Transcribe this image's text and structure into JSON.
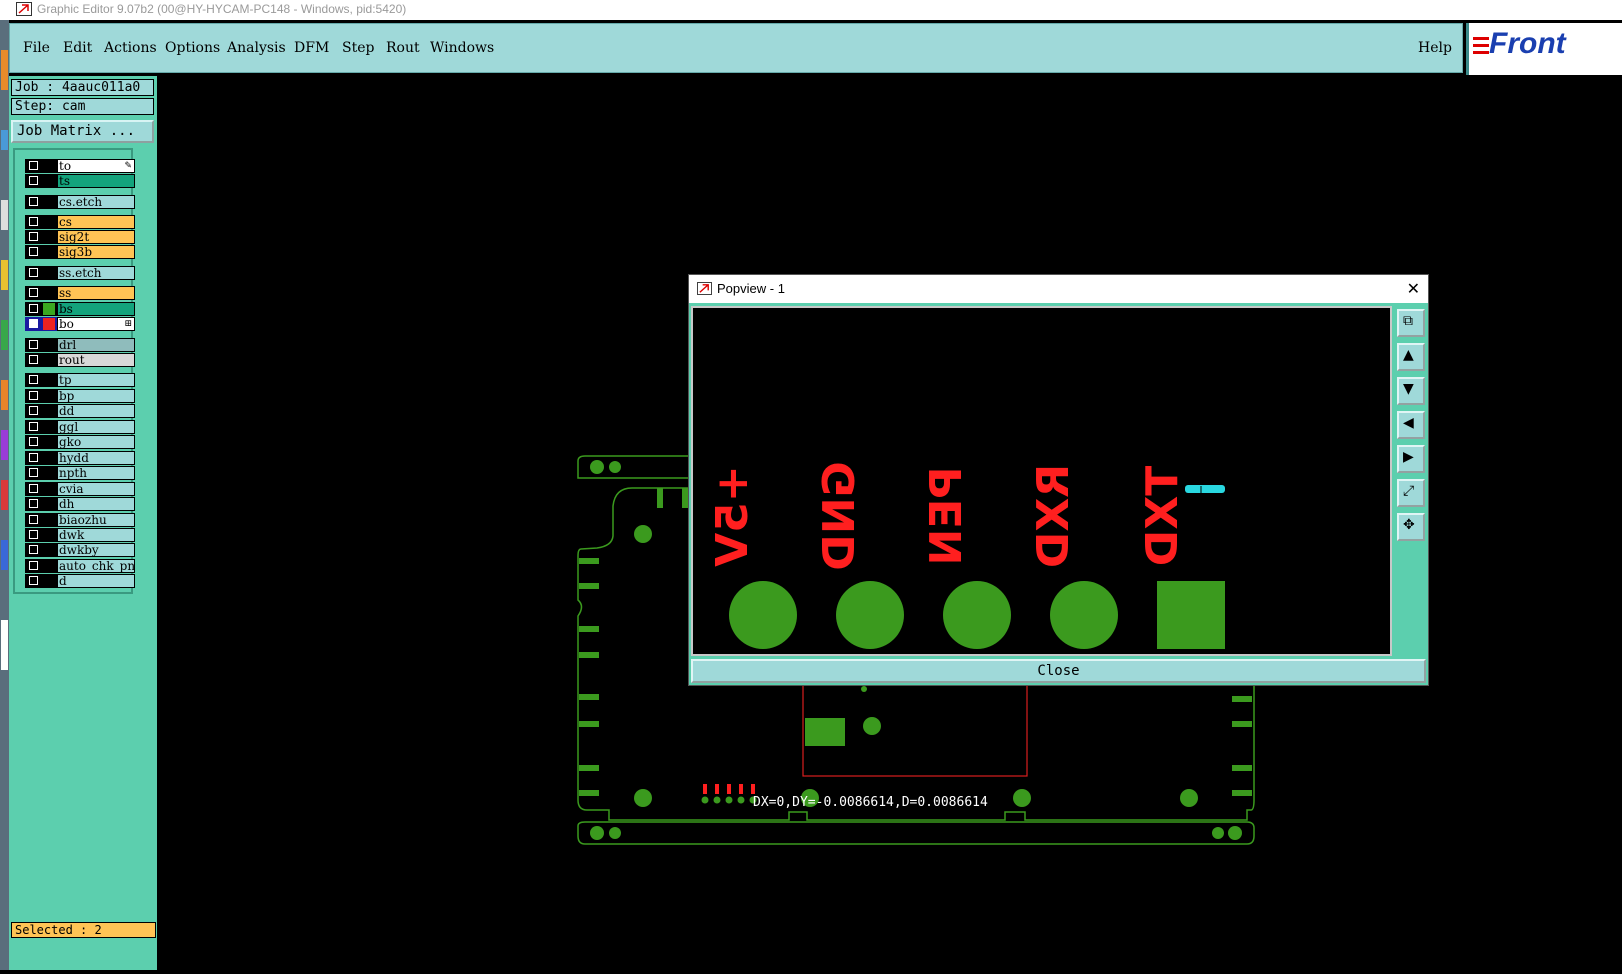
{
  "window": {
    "title": "Graphic Editor 9.07b2 (00@HY-HYCAM-PC148 - Windows, pid:5420)"
  },
  "menu": {
    "items": [
      "File",
      "Edit",
      "Actions",
      "Options",
      "Analysis",
      "DFM",
      "Step",
      "Rout",
      "Windows"
    ],
    "help": "Help",
    "logo_text": "Front"
  },
  "panel": {
    "job": "Job : 4aauc011a0",
    "step": "Step: cam",
    "job_matrix": "Job Matrix ...",
    "selected": "Selected : 2"
  },
  "layers": [
    {
      "name": "to",
      "color": "#ffffff",
      "marker": "pen"
    },
    {
      "name": "ts",
      "color": "#13a37c"
    },
    {
      "name": "cs.etch",
      "color": "#9fd9d9"
    },
    {
      "name": "cs",
      "color": "#ffc455"
    },
    {
      "name": "sig2t",
      "color": "#ffc455"
    },
    {
      "name": "sig3b",
      "color": "#ffc455"
    },
    {
      "name": "ss.etch",
      "color": "#9fd9d9"
    },
    {
      "name": "ss",
      "color": "#ffc455"
    },
    {
      "name": "bs",
      "color": "#13a37c",
      "swatch": "#3aa820"
    },
    {
      "name": "bo",
      "color": "#ffffff",
      "active": true,
      "marker": "plus"
    },
    {
      "name": "drl",
      "color": "#8fbcbc"
    },
    {
      "name": "rout",
      "color": "#d8d8d8"
    },
    {
      "name": "tp",
      "color": "#9fd9d9"
    },
    {
      "name": "bp",
      "color": "#9fd9d9"
    },
    {
      "name": "dd",
      "color": "#9fd9d9"
    },
    {
      "name": "ggl",
      "color": "#9fd9d9"
    },
    {
      "name": "gko",
      "color": "#9fd9d9"
    },
    {
      "name": "hydd",
      "color": "#9fd9d9"
    },
    {
      "name": "npth",
      "color": "#9fd9d9"
    },
    {
      "name": "cvia",
      "color": "#9fd9d9"
    },
    {
      "name": "dh",
      "color": "#9fd9d9"
    },
    {
      "name": "biaozhu",
      "color": "#9fd9d9"
    },
    {
      "name": "dwk",
      "color": "#9fd9d9"
    },
    {
      "name": "dwkby",
      "color": "#9fd9d9"
    },
    {
      "name": "auto_chk_pnl",
      "color": "#9fd9d9"
    },
    {
      "name": "d",
      "color": "#9fd9d9"
    }
  ],
  "canvas": {
    "readout": "DX=0,DY=-0.0086614,D=0.0086614",
    "pcb_color": "#3b9a1e",
    "silk_color": "#ff1f1f"
  },
  "popview": {
    "title": "Popview - 1",
    "close_label": "Close",
    "pad_labels": [
      "+5V",
      "GND",
      "PEN",
      "RXD",
      "TXD"
    ],
    "tools": [
      "zoom-window-icon",
      "pan-up-icon",
      "pan-down-icon",
      "pan-left-icon",
      "pan-right-icon",
      "zoom-fit-icon",
      "zoom-home-icon"
    ]
  }
}
